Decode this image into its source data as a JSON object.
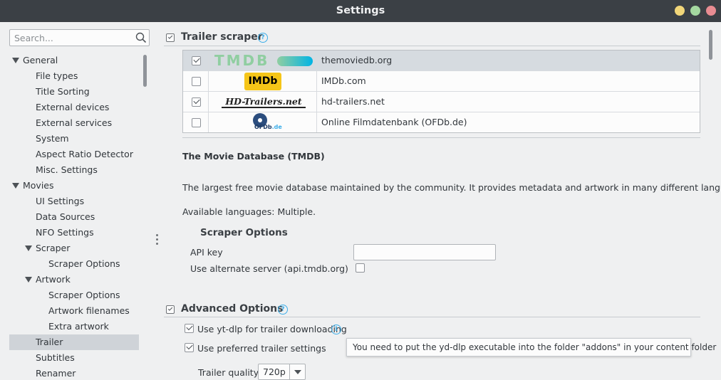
{
  "window": {
    "title": "Settings"
  },
  "search": {
    "placeholder": "Search..."
  },
  "tree": [
    {
      "label": "General",
      "level": 0,
      "expanded": true
    },
    {
      "label": "File types",
      "level": 1
    },
    {
      "label": "Title Sorting",
      "level": 1
    },
    {
      "label": "External devices",
      "level": 1
    },
    {
      "label": "External services",
      "level": 1
    },
    {
      "label": "System",
      "level": 1
    },
    {
      "label": "Aspect Ratio Detector",
      "level": 1
    },
    {
      "label": "Misc. Settings",
      "level": 1
    },
    {
      "label": "Movies",
      "level": 0,
      "expanded": true
    },
    {
      "label": "UI Settings",
      "level": 1
    },
    {
      "label": "Data Sources",
      "level": 1
    },
    {
      "label": "NFO Settings",
      "level": 1
    },
    {
      "label": "Scraper",
      "level": 1,
      "expanded": true
    },
    {
      "label": "Scraper Options",
      "level": 2
    },
    {
      "label": "Artwork",
      "level": 1,
      "expanded": true
    },
    {
      "label": "Scraper Options",
      "level": 2
    },
    {
      "label": "Artwork filenames",
      "level": 2
    },
    {
      "label": "Extra artwork",
      "level": 2
    },
    {
      "label": "Trailer",
      "level": 1,
      "selected": true
    },
    {
      "label": "Subtitles",
      "level": 1
    },
    {
      "label": "Renamer",
      "level": 1
    }
  ],
  "trailer_scraper": {
    "title": "Trailer scraper",
    "help_glyph": "?",
    "scrapers": [
      {
        "logo": "TMDB",
        "name": "themoviedb.org",
        "checked": true,
        "selected": true
      },
      {
        "logo": "IMDb",
        "name": "IMDb.com",
        "checked": false
      },
      {
        "logo": "HD-Trailers.net",
        "name": "hd-trailers.net",
        "checked": true
      },
      {
        "logo": "OFDb",
        "logo_suffix": ".de",
        "name": "Online Filmdatenbank (OFDb.de)",
        "checked": false
      }
    ],
    "details": {
      "name": "The Movie Database (TMDB)",
      "description": "The largest free movie database maintained by the community. It provides metadata and artwork in many different languages.",
      "languages": "Available languages: Multiple."
    },
    "options": {
      "title": "Scraper Options",
      "api_key_label": "API key",
      "api_key_value": "",
      "alt_server_label": "Use alternate server (api.tmdb.org)",
      "alt_server_checked": false
    }
  },
  "advanced": {
    "title": "Advanced Options",
    "help_glyph": "?",
    "ytdlp_label": "Use yt-dlp for trailer downloading",
    "ytdlp_checked": true,
    "info_glyph": "i",
    "preferred_label": "Use preferred trailer settings",
    "preferred_checked": true,
    "tooltip": "You need to put the yd-dlp executable into the folder \"addons\" in your content folder",
    "quality_label": "Trailer quality",
    "quality_value": "720p"
  },
  "colors": {
    "accent": "#3daee9",
    "selection": "#cfd3d8",
    "titlebar": "#3b4045"
  }
}
